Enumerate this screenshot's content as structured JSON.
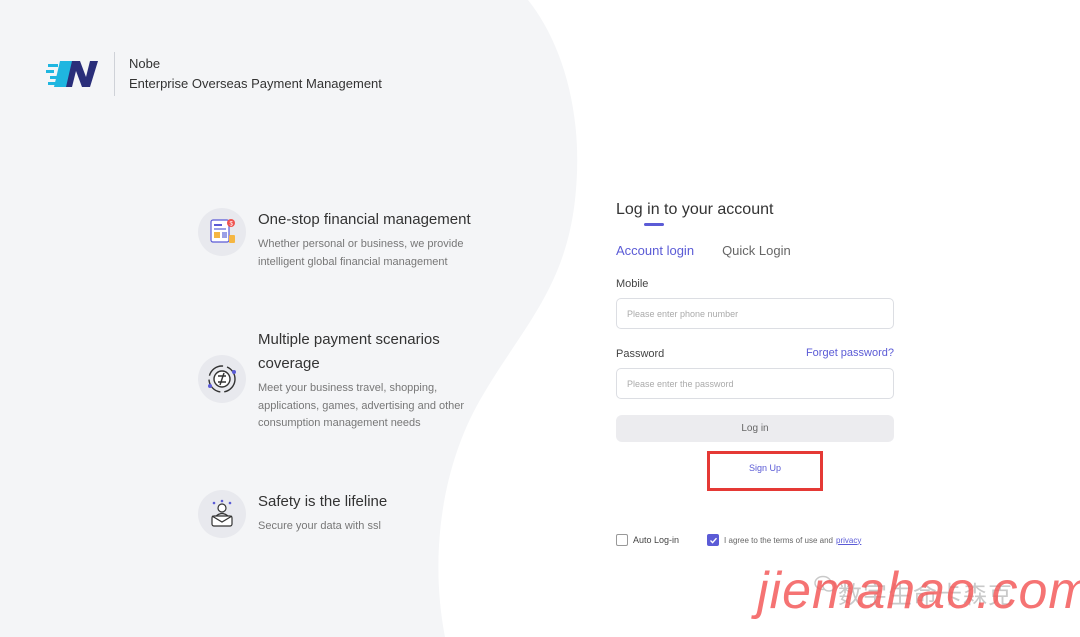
{
  "brand": {
    "name": "Nobe",
    "tagline": "Enterprise Overseas Payment Management",
    "colors": {
      "primary": "#5b5bd6",
      "navy": "#2a2e7a",
      "cyan": "#1fb6e0"
    }
  },
  "features": [
    {
      "icon": "finance-document-icon",
      "title": "One-stop financial management",
      "description": "Whether personal or business, we provide intelligent global financial management"
    },
    {
      "icon": "payment-scenarios-icon",
      "title": "Multiple payment scenarios coverage",
      "description": "Meet your business travel, shopping, applications, games, advertising and other consumption management needs"
    },
    {
      "icon": "security-icon",
      "title": "Safety is the lifeline",
      "description": "Secure your data with ssl"
    }
  ],
  "login": {
    "title": "Log in to your account",
    "tabs": [
      {
        "label": "Account login",
        "active": true
      },
      {
        "label": "Quick Login",
        "active": false
      }
    ],
    "mobile": {
      "label": "Mobile",
      "placeholder": "Please enter phone number",
      "value": ""
    },
    "password": {
      "label": "Password",
      "placeholder": "Please enter the password",
      "value": "",
      "forgot": "Forget password?"
    },
    "login_button": "Log in",
    "signup_link": "Sign Up",
    "auto_login": {
      "label": "Auto Log-in",
      "checked": false
    },
    "agree": {
      "label": "I agree to the terms of use and",
      "link": "privacy",
      "checked": true
    }
  },
  "watermark": {
    "cn": "数字生命卡森克",
    "en": "jiemahao.com"
  },
  "colors": {
    "page_bg": "#f4f5f7",
    "highlight_border": "#e53935",
    "button_bg": "#ececef"
  }
}
